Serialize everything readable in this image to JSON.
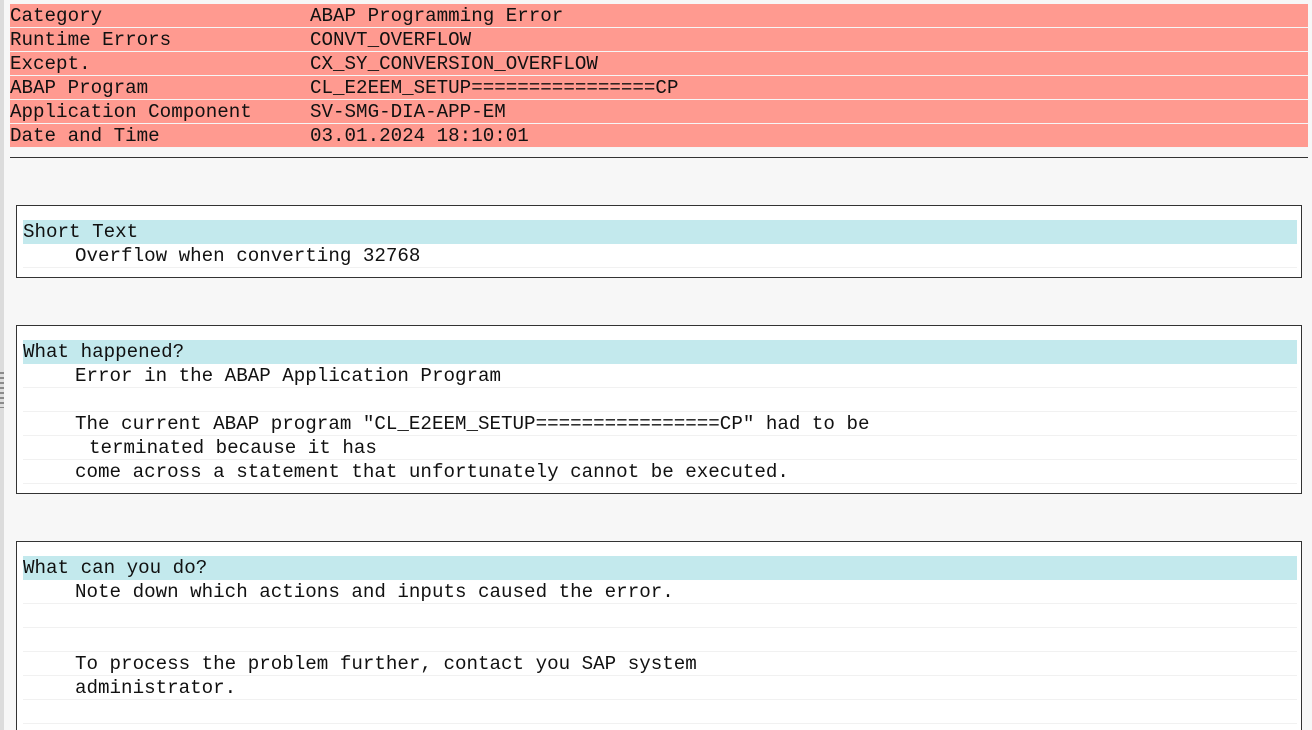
{
  "header": {
    "rows": [
      {
        "key": "Category",
        "value": "ABAP Programming Error"
      },
      {
        "key": "Runtime Errors",
        "value": "CONVT_OVERFLOW"
      },
      {
        "key": "Except.",
        "value": "CX_SY_CONVERSION_OVERFLOW"
      },
      {
        "key": "ABAP Program",
        "value": "CL_E2EEM_SETUP================CP"
      },
      {
        "key": "Application Component",
        "value": "SV-SMG-DIA-APP-EM"
      },
      {
        "key": "Date and Time",
        "value": "03.01.2024 18:10:01"
      }
    ]
  },
  "sections": {
    "short_text": {
      "title": "Short Text",
      "lines": [
        "Overflow when converting 32768"
      ]
    },
    "what_happened": {
      "title": "What happened?",
      "lines": [
        "Error in the ABAP Application Program",
        "",
        "The current ABAP program \"CL_E2EEM_SETUP================CP\" had to be",
        "terminated because it has",
        "come across a statement that unfortunately cannot be executed."
      ]
    },
    "what_can_you_do": {
      "title": "What can you do?",
      "lines": [
        "Note down which actions and inputs caused the error.",
        "",
        "",
        "To process the problem further, contact you SAP system",
        "administrator.",
        ""
      ]
    }
  },
  "colors": {
    "header_bg": "#ff9a90",
    "section_title_bg": "#c3e9ed",
    "page_bg": "#f7f7f7"
  }
}
